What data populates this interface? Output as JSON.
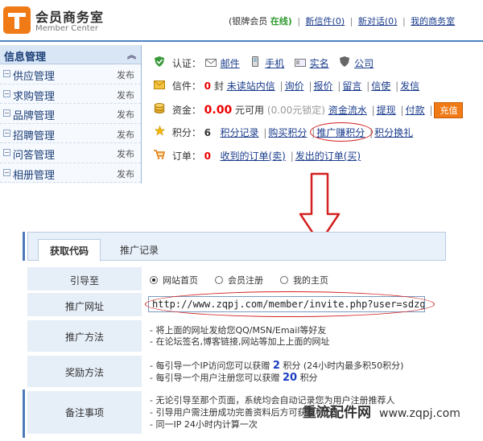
{
  "header": {
    "title": "会员商务室",
    "subtitle": "Member Center",
    "member_type": "(银牌会员",
    "status": "在线)",
    "links": [
      "新信件(0)",
      "新对话(0)",
      "我的商务室"
    ],
    "separator": "|"
  },
  "sidebar": {
    "title": "信息管理",
    "collapse_icon": "︽",
    "items": [
      {
        "label": "供应管理",
        "action": "发布"
      },
      {
        "label": "求购管理",
        "action": "发布"
      },
      {
        "label": "品牌管理",
        "action": "发布"
      },
      {
        "label": "招聘管理",
        "action": "发布"
      },
      {
        "label": "问答管理",
        "action": "发布"
      },
      {
        "label": "相册管理",
        "action": "发布"
      }
    ],
    "box_glyph": "−"
  },
  "info": {
    "auth": {
      "label": "认证：",
      "items": [
        "邮件",
        "手机",
        "实名",
        "公司"
      ]
    },
    "mail": {
      "label": "信件：",
      "count": "0",
      "unit": "封",
      "links": [
        "未读站内信",
        "询价",
        "报价",
        "留言",
        "信使",
        "发信"
      ]
    },
    "funds": {
      "label": "资金：",
      "amount": "0.00",
      "available": "元可用",
      "locked": "(0.00元锁定)",
      "links": [
        "资金流水",
        "提现",
        "付款"
      ],
      "recharge": "充值"
    },
    "points": {
      "label": "积分：",
      "count": "6",
      "links": [
        "积分记录",
        "购买积分",
        "推广赚积分",
        "积分换礼"
      ]
    },
    "orders": {
      "label": "订单：",
      "count": "0",
      "links": [
        "收到的订单(卖)",
        "发出的订单(买)"
      ]
    }
  },
  "tabs": [
    "获取代码",
    "推广记录"
  ],
  "form": {
    "guide": {
      "label": "引导至",
      "options": [
        "网站首页",
        "会员注册",
        "我的主页"
      ]
    },
    "url": {
      "label": "推广网址",
      "value": "http://www.zqpj.com/member/invite.php?user=sdzgmy"
    },
    "method": {
      "label": "推广方法",
      "lines": [
        "- 将上面的网址发给您QQ/MSN/Email等好友",
        "- 在论坛签名,博客链接,网站等加上上面的网址"
      ]
    },
    "reward": {
      "label": "奖励方法",
      "line1_pre": "- 每引导一个IP访问您可以获赠",
      "line1_num": "2",
      "line1_post": "积分 (24小时内最多积50积分)",
      "line2_pre": "- 每引导一个用户注册您可以获赠",
      "line2_num": "20",
      "line2_post": "积分"
    },
    "notes": {
      "label": "备注事项",
      "lines": [
        "- 无论引导至那个页面，系统均会自动记录您为用户注册推荐人",
        "- 引导用户需注册成功完善资料后方可获赠积分",
        "- 同一IP 24小时内计算一次"
      ]
    }
  },
  "watermark": {
    "text": "重流配件网",
    "url": "www.zqpj.com"
  },
  "colors": {
    "accent": "#f07a16",
    "highlight_circle": "#d42020",
    "link": "#1a3c8c",
    "label_bg": "#e6eef8"
  }
}
